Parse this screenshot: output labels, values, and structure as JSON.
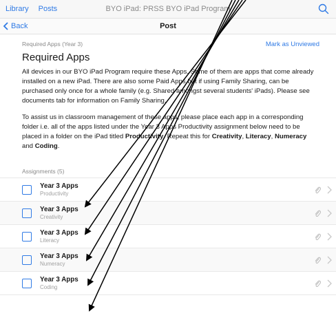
{
  "topbar": {
    "library": "Library",
    "posts": "Posts",
    "title": "BYO iPad: PRSS BYO iPad Program"
  },
  "navbar": {
    "back": "Back",
    "title": "Post"
  },
  "post": {
    "crumb": "Required Apps (Year 3)",
    "mark_unviewed": "Mark as Unviewed",
    "heading": "Required Apps",
    "para1": "All devices in our BYO iPad Program require these Apps. Some of them are apps that come already installed on a new iPad. There are also some Paid Apps but if using Family Sharing, can be purchased only once for a whole family (e.g. Shared amongst several students' iPads). Please see documents tab for information on Family Sharing.",
    "para2_a": "To assist us in classroom management of these apps, please place each app in a corresponding folder i.e. all of the apps listed under the Year 3 Apps Productivity assignment below need to be placed in a folder on the iPad titled ",
    "para2_b1": "Productivity",
    "para2_c": ". Repeat this for ",
    "para2_b2": "Creativity",
    "para2_comma1": ", ",
    "para2_b3": "Literacy",
    "para2_comma2": ", ",
    "para2_b4": "Numeracy",
    "para2_and": " and ",
    "para2_b5": "Coding",
    "para2_end": "."
  },
  "assignments": {
    "header": "Assignments (5)",
    "items": [
      {
        "title": "Year 3 Apps",
        "subtitle": "Productivity"
      },
      {
        "title": "Year 3 Apps",
        "subtitle": "Creativity"
      },
      {
        "title": "Year 3 Apps",
        "subtitle": "Literacy"
      },
      {
        "title": "Year 3 Apps",
        "subtitle": "Numeracy"
      },
      {
        "title": "Year 3 Apps",
        "subtitle": "Coding"
      }
    ]
  },
  "icons": [
    "search-icon",
    "chevron-left-icon",
    "paperclip-icon",
    "chevron-right-icon",
    "arrow-annotation"
  ],
  "colors": {
    "accent": "#2f7ae5",
    "secondary_text": "#8a8a8a",
    "annotation": "#000000"
  }
}
